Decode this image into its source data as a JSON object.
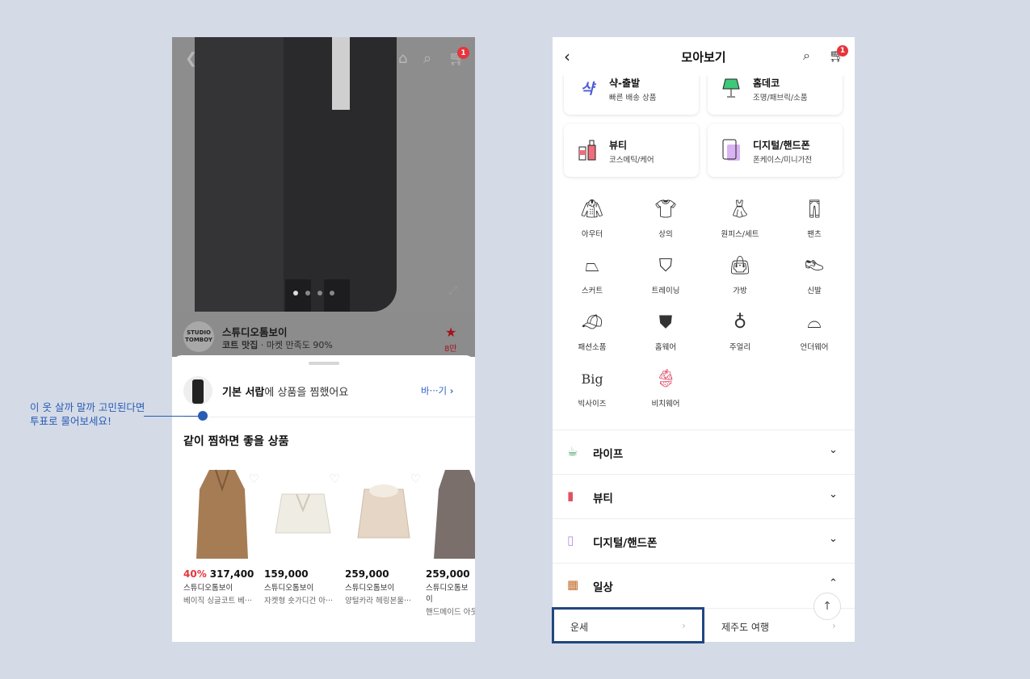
{
  "left": {
    "cart_count": "1",
    "brand": {
      "logo_text": "STUDIO TOMBOY",
      "name": "스튜디오톰보이",
      "sub_bold": "코트 맛집",
      "sub_rest": " · 마켓 만족도 90%",
      "likes": "8만"
    },
    "drawer": {
      "name": "기본 서랍",
      "message": "에 상품을 찜했어요",
      "change": "바···기"
    },
    "rec_title": "같이 찜하면 좋을 상품",
    "products": [
      {
        "discount": "40%",
        "price": "317,400",
        "brand": "스튜디오톰보이",
        "name": "베이직 싱글코트 베···",
        "color": "#a67c55"
      },
      {
        "discount": "",
        "price": "159,000",
        "brand": "스튜디오톰보이",
        "name": "자켓형 숏가디건 아···",
        "color": "#efece3"
      },
      {
        "discount": "",
        "price": "259,000",
        "brand": "스튜디오톰보이",
        "name": "양털카라 헤링본울···",
        "color": "#e5d6c6"
      },
      {
        "discount": "",
        "price": "259,000",
        "brand": "스튜디오톰보이",
        "name": "핸드메이드 아웃",
        "color": "#7b6f6b"
      }
    ]
  },
  "annotation": {
    "line1": "이 옷 살까 말까 고민된다면",
    "line2": "투표로 물어보세요!"
  },
  "right": {
    "title": "모아보기",
    "cart_count": "1",
    "services": [
      {
        "title": "샥-출발",
        "sub": "빠른 배송 상품",
        "icon": "rocket-icon"
      },
      {
        "title": "홈데코",
        "sub": "조명/패브릭/소품",
        "icon": "lamp-icon"
      },
      {
        "title": "뷰티",
        "sub": "코스메틱/케어",
        "icon": "cosmetic-icon"
      },
      {
        "title": "디지털/핸드폰",
        "sub": "폰케이스/미니가전",
        "icon": "phone-icon"
      }
    ],
    "categories": [
      "아우터",
      "상의",
      "원피스/세트",
      "팬츠",
      "스커트",
      "트레이닝",
      "가방",
      "신발",
      "패션소품",
      "홈웨어",
      "주얼리",
      "언더웨어",
      "빅사이즈",
      "비치웨어"
    ],
    "big_label": "Big",
    "accordions": [
      {
        "label": "라이프",
        "chev": "⌄"
      },
      {
        "label": "뷰티",
        "chev": "⌄"
      },
      {
        "label": "디지털/핸드폰",
        "chev": "⌄"
      },
      {
        "label": "일상",
        "chev": "⌃"
      }
    ],
    "sub_items": [
      "운세",
      "제주도 여행"
    ]
  }
}
